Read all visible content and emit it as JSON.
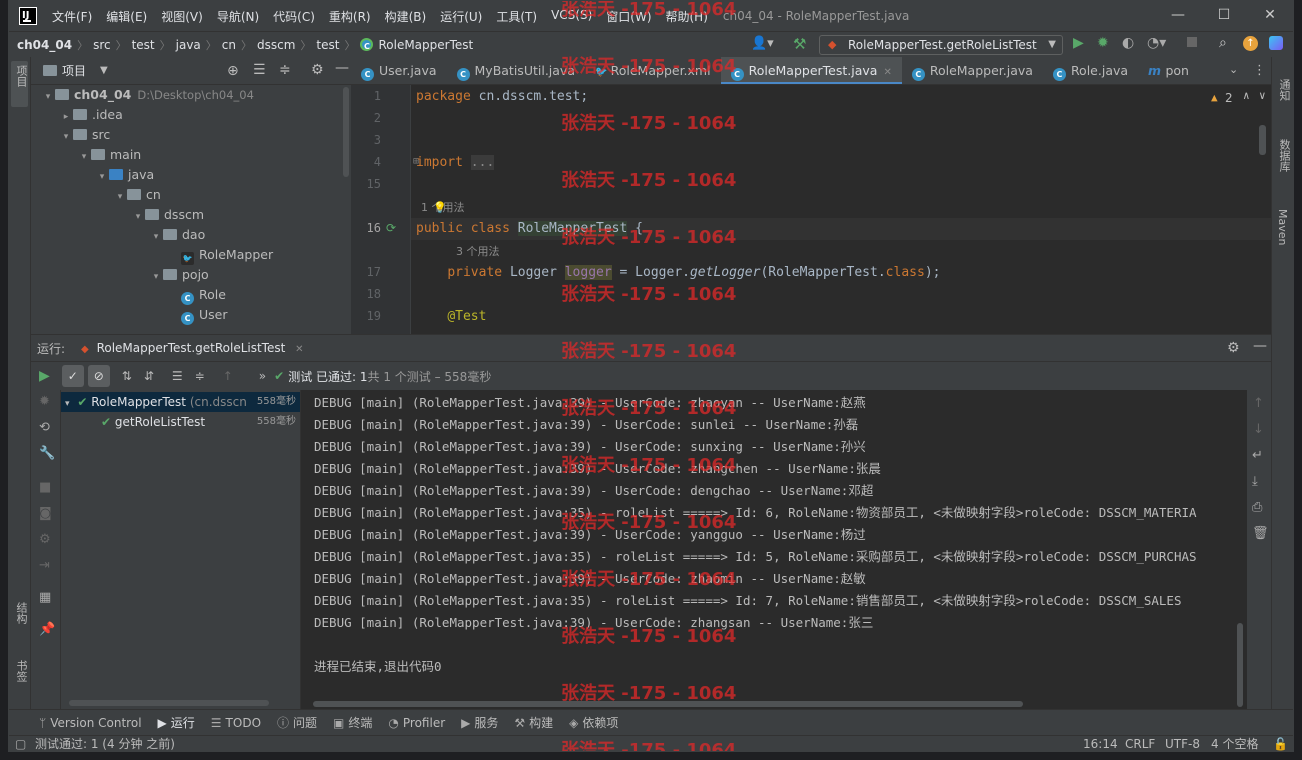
{
  "window": {
    "title": "ch04_04 - RoleMapperTest.java",
    "menu": [
      "文件(F)",
      "编辑(E)",
      "视图(V)",
      "导航(N)",
      "代码(C)",
      "重构(R)",
      "构建(B)",
      "运行(U)",
      "工具(T)",
      "VCS(S)",
      "窗口(W)",
      "帮助(H)"
    ],
    "controls": [
      "—",
      "☐",
      "✕"
    ]
  },
  "navbar": {
    "crumbs": [
      "ch04_04",
      "src",
      "test",
      "java",
      "cn",
      "dsscm",
      "test",
      "RoleMapperTest"
    ],
    "run_config": "RoleMapperTest.getRoleListTest"
  },
  "project_panel": {
    "title": "项目",
    "tree": [
      {
        "label": "ch04_04",
        "extra": "D:\\Desktop\\ch04_04",
        "depth": 0,
        "arrow": "▾",
        "kind": "folder"
      },
      {
        "label": ".idea",
        "depth": 1,
        "arrow": "▸",
        "kind": "folder"
      },
      {
        "label": "src",
        "depth": 1,
        "arrow": "▾",
        "kind": "folder"
      },
      {
        "label": "main",
        "depth": 2,
        "arrow": "▾",
        "kind": "folder"
      },
      {
        "label": "java",
        "depth": 3,
        "arrow": "▾",
        "kind": "folder-blue"
      },
      {
        "label": "cn",
        "depth": 4,
        "arrow": "▾",
        "kind": "folder"
      },
      {
        "label": "dsscm",
        "depth": 5,
        "arrow": "▾",
        "kind": "folder"
      },
      {
        "label": "dao",
        "depth": 6,
        "arrow": "▾",
        "kind": "folder"
      },
      {
        "label": "RoleMapper",
        "depth": 7,
        "arrow": "",
        "kind": "mapper"
      },
      {
        "label": "pojo",
        "depth": 6,
        "arrow": "▾",
        "kind": "folder"
      },
      {
        "label": "Role",
        "depth": 7,
        "arrow": "",
        "kind": "class"
      },
      {
        "label": "User",
        "depth": 7,
        "arrow": "",
        "kind": "class"
      }
    ]
  },
  "editor": {
    "tabs": [
      {
        "label": "User.java",
        "active": false
      },
      {
        "label": "MyBatisUtil.java",
        "active": false
      },
      {
        "label": "RoleMapper.xml",
        "active": false
      },
      {
        "label": "RoleMapperTest.java",
        "active": true
      },
      {
        "label": "RoleMapper.java",
        "active": false
      },
      {
        "label": "Role.java",
        "active": false
      },
      {
        "label": "pon",
        "active": false
      }
    ],
    "warnings": "2",
    "lines": [
      {
        "n": "1",
        "text": "package cn.dsscm.test;"
      },
      {
        "n": "2",
        "text": ""
      },
      {
        "n": "3",
        "text": ""
      },
      {
        "n": "4",
        "text": "import ..."
      },
      {
        "n": "15",
        "text": ""
      },
      {
        "n": "16",
        "text": "public class RoleMapperTest {"
      },
      {
        "n": "17",
        "text": "    private Logger logger = Logger.getLogger(RoleMapperTest.class);"
      },
      {
        "n": "18",
        "text": ""
      },
      {
        "n": "19",
        "text": "    @Test"
      }
    ],
    "usage_hints": [
      "1 个用法",
      "3 个用法"
    ]
  },
  "run_panel": {
    "label": "运行:",
    "tab": "RoleMapperTest.getRoleListTest",
    "status_pass": "测试 已通过: 1",
    "status_rest": "共 1 个测试 – 558毫秒",
    "tests": [
      {
        "name": "RoleMapperTest",
        "pkg": "(cn.dsscn",
        "time": "558毫秒"
      },
      {
        "name": "getRoleListTest",
        "pkg": "",
        "time": "558毫秒"
      }
    ],
    "console": [
      "DEBUG [main] (RoleMapperTest.java:39) - UserCode: zhaoyan -- UserName:赵燕",
      "DEBUG [main] (RoleMapperTest.java:39) - UserCode: sunlei -- UserName:孙磊",
      "DEBUG [main] (RoleMapperTest.java:39) - UserCode: sunxing -- UserName:孙兴",
      "DEBUG [main] (RoleMapperTest.java:39) - UserCode: zhangchen -- UserName:张晨",
      "DEBUG [main] (RoleMapperTest.java:39) - UserCode: dengchao -- UserName:邓超",
      "DEBUG [main] (RoleMapperTest.java:35) - roleList =====> Id: 6, RoleName:物资部员工, <未做映射字段>roleCode: DSSCM_MATERIA",
      "DEBUG [main] (RoleMapperTest.java:39) - UserCode: yangguo -- UserName:杨过",
      "DEBUG [main] (RoleMapperTest.java:35) - roleList =====> Id: 5, RoleName:采购部员工, <未做映射字段>roleCode: DSSCM_PURCHAS",
      "DEBUG [main] (RoleMapperTest.java:39) - UserCode: zhaomin -- UserName:赵敏",
      "DEBUG [main] (RoleMapperTest.java:35) - roleList =====> Id: 7, RoleName:销售部员工, <未做映射字段>roleCode: DSSCM_SALES",
      "DEBUG [main] (RoleMapperTest.java:39) - UserCode: zhangsan -- UserName:张三",
      "",
      "进程已结束,退出代码0"
    ]
  },
  "tool_windows": [
    "Version Control",
    "运行",
    "TODO",
    "问题",
    "终端",
    "Profiler",
    "服务",
    "构建",
    "依赖项"
  ],
  "statusbar": {
    "message": "测试通过: 1 (4 分钟 之前)",
    "position": "16:14",
    "line_sep": "CRLF",
    "encoding": "UTF-8",
    "indent": "4 个空格"
  },
  "side_labels": {
    "left_top": "项目",
    "left_struct": "结构",
    "left_bookmark": "书签",
    "right_notify": "通知",
    "right_db": "数据库",
    "right_maven": "Maven"
  },
  "watermark": "张浩天 -175 - 1064"
}
